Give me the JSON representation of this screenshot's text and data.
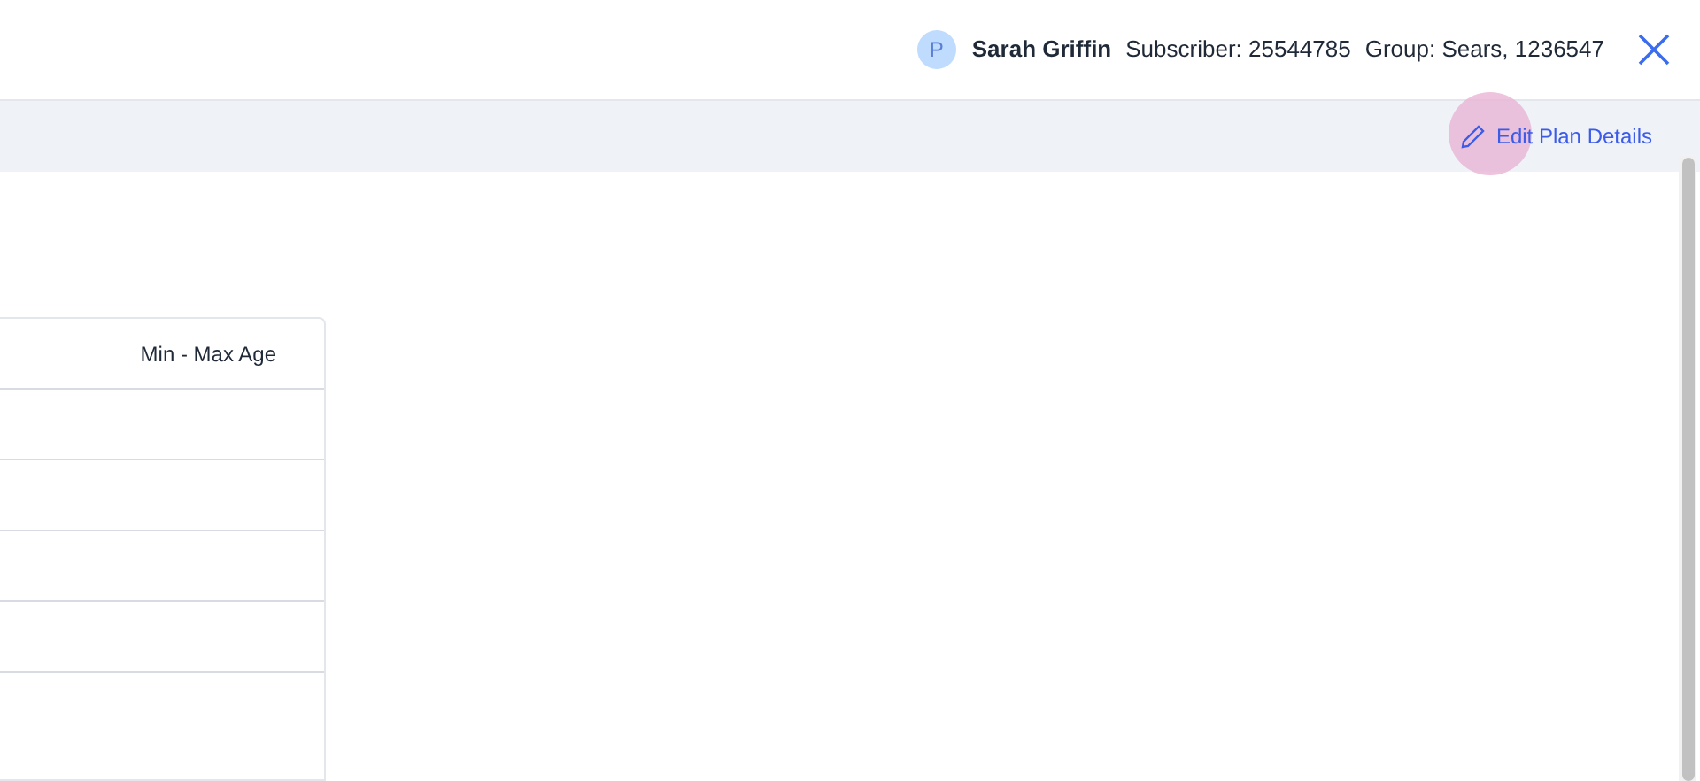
{
  "header": {
    "avatar_initial": "P",
    "name": "Sarah Griffin",
    "subscriber": "Subscriber: 25544785",
    "group": "Group: Sears, 1236547"
  },
  "toolbar": {
    "edit_link": "Edit Plan Details"
  },
  "table": {
    "columns": [
      "Min - Max Age"
    ]
  }
}
